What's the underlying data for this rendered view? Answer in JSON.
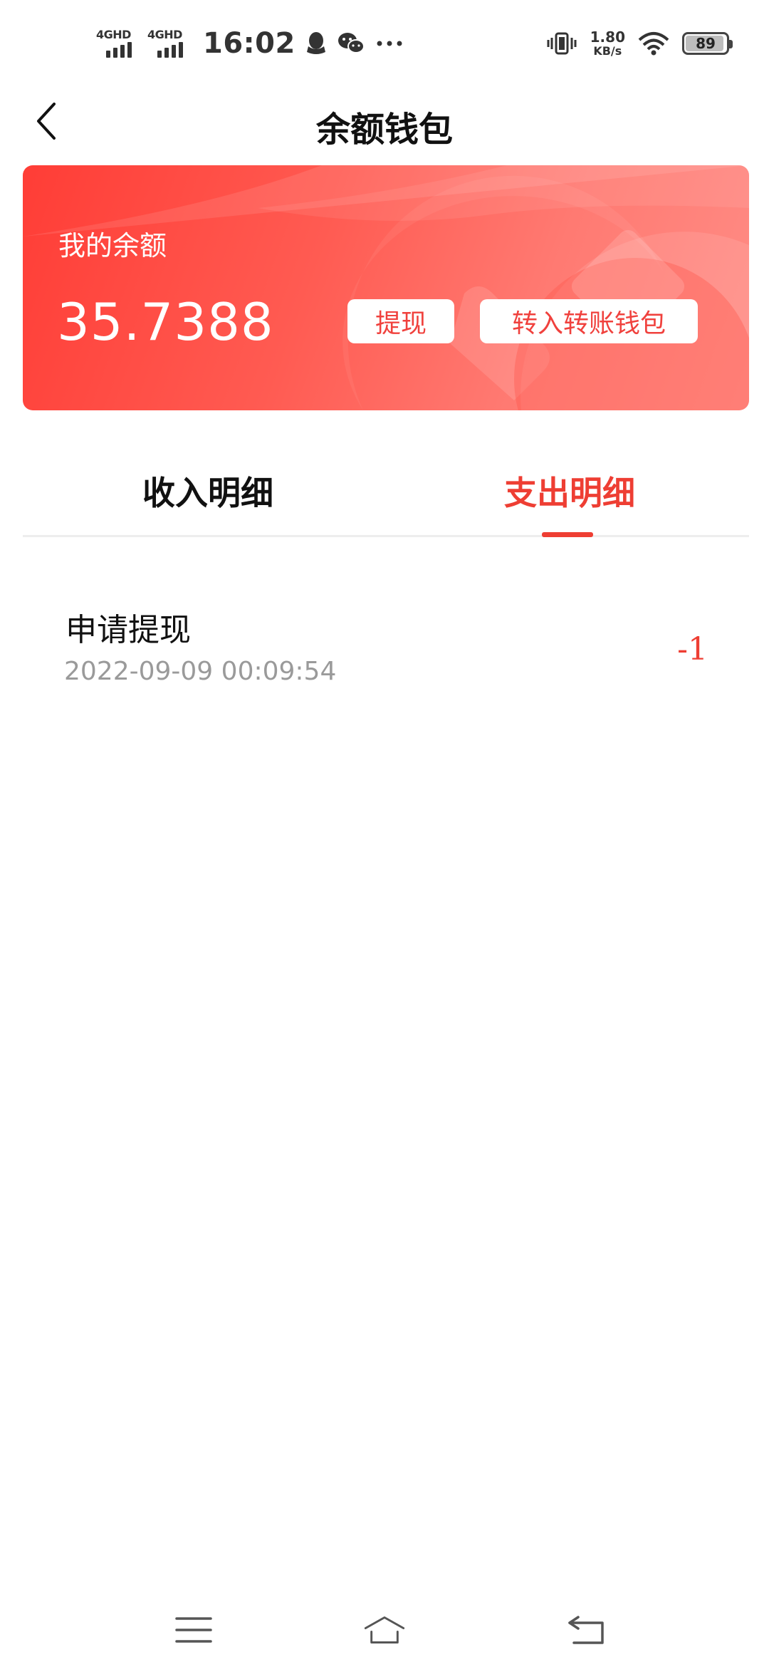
{
  "status_bar": {
    "sim1_label": "4GHD",
    "sim2_label": "4GHD",
    "time": "16:02",
    "net_speed_value": "1.80",
    "net_speed_unit": "KB/s",
    "battery_level": "89",
    "icons": [
      "qq-icon",
      "wechat-icon",
      "more-dots-icon",
      "vibrate-icon",
      "wifi-icon",
      "battery-icon"
    ]
  },
  "header": {
    "title": "余额钱包",
    "back_icon": "chevron-left-icon"
  },
  "balance_card": {
    "label": "我的余额",
    "amount": "35.7388",
    "withdraw_label": "提现",
    "transfer_label": "转入转账钱包"
  },
  "tabs": [
    {
      "label": "收入明细",
      "active": false
    },
    {
      "label": "支出明细",
      "active": true
    }
  ],
  "records": [
    {
      "title": "申请提现",
      "datetime": "2022-09-09 00:09:54",
      "amount": "-1"
    }
  ],
  "nav_bar": {
    "icons": [
      "menu-icon",
      "home-icon",
      "back-icon"
    ]
  },
  "colors": {
    "accent": "#ee3e33",
    "card_gradient_start": "#ff3d36",
    "card_gradient_end": "#ff8d86",
    "muted_text": "#9a9a9a"
  }
}
